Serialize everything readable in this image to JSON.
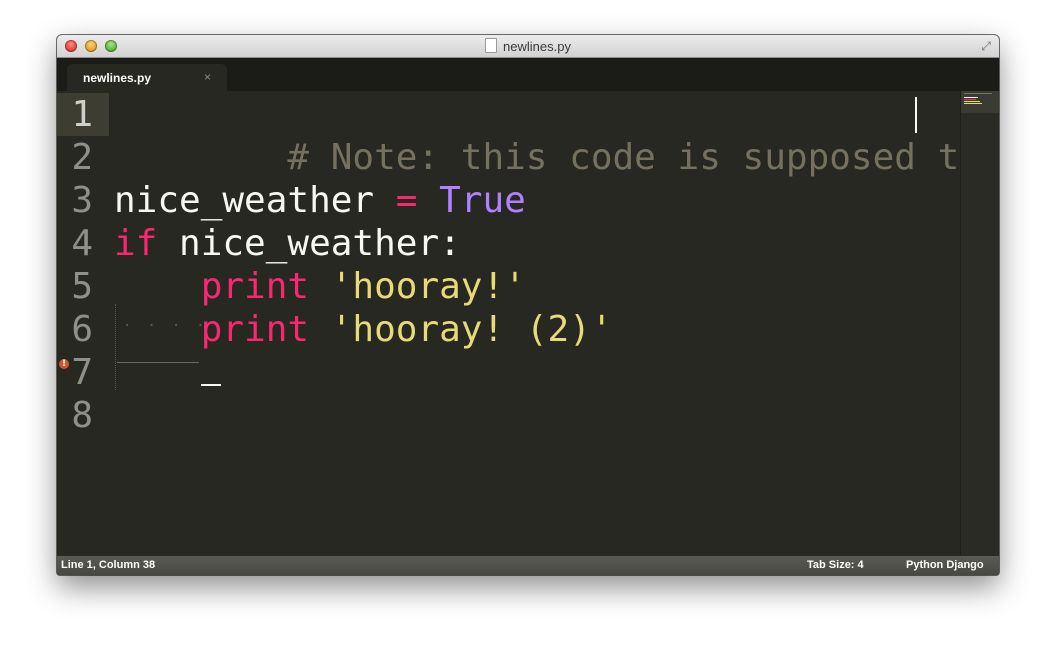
{
  "window": {
    "title": "newlines.py"
  },
  "tabs": [
    {
      "label": "newlines.py",
      "close_glyph": "×"
    }
  ],
  "editor": {
    "line_numbers": [
      "1",
      "2",
      "3",
      "4",
      "5",
      "6",
      "7",
      "8"
    ],
    "active_line": "1",
    "error_line": "6",
    "error_glyph": "!",
    "lines": [
      {
        "comment": "# Note: this code is supposed to fail"
      },
      {},
      {
        "ident": "nice_weather ",
        "op": "= ",
        "const": "True"
      },
      {
        "kw": "if ",
        "ident": "nice_weather:"
      },
      {
        "indent": "    ",
        "kw": "print ",
        "str": "'hooray!'"
      },
      {
        "indent": "    ",
        "kw": "print ",
        "str": "'hooray! (2)'"
      },
      {},
      {}
    ]
  },
  "statusbar": {
    "position": "Line 1, Column 38",
    "tab_size": "Tab Size: 4",
    "syntax": "Python Django"
  },
  "colors": {
    "background": "#272822",
    "comment": "#75715e",
    "keyword": "#f92672",
    "constant": "#ae81ff",
    "string": "#e6db74",
    "identifier": "#f8f8f2"
  },
  "icons": {
    "close": "close-icon",
    "minimize": "minimize-icon",
    "zoom": "zoom-icon",
    "document": "document-icon",
    "fullscreen": "fullscreen-icon",
    "error": "error-icon"
  }
}
